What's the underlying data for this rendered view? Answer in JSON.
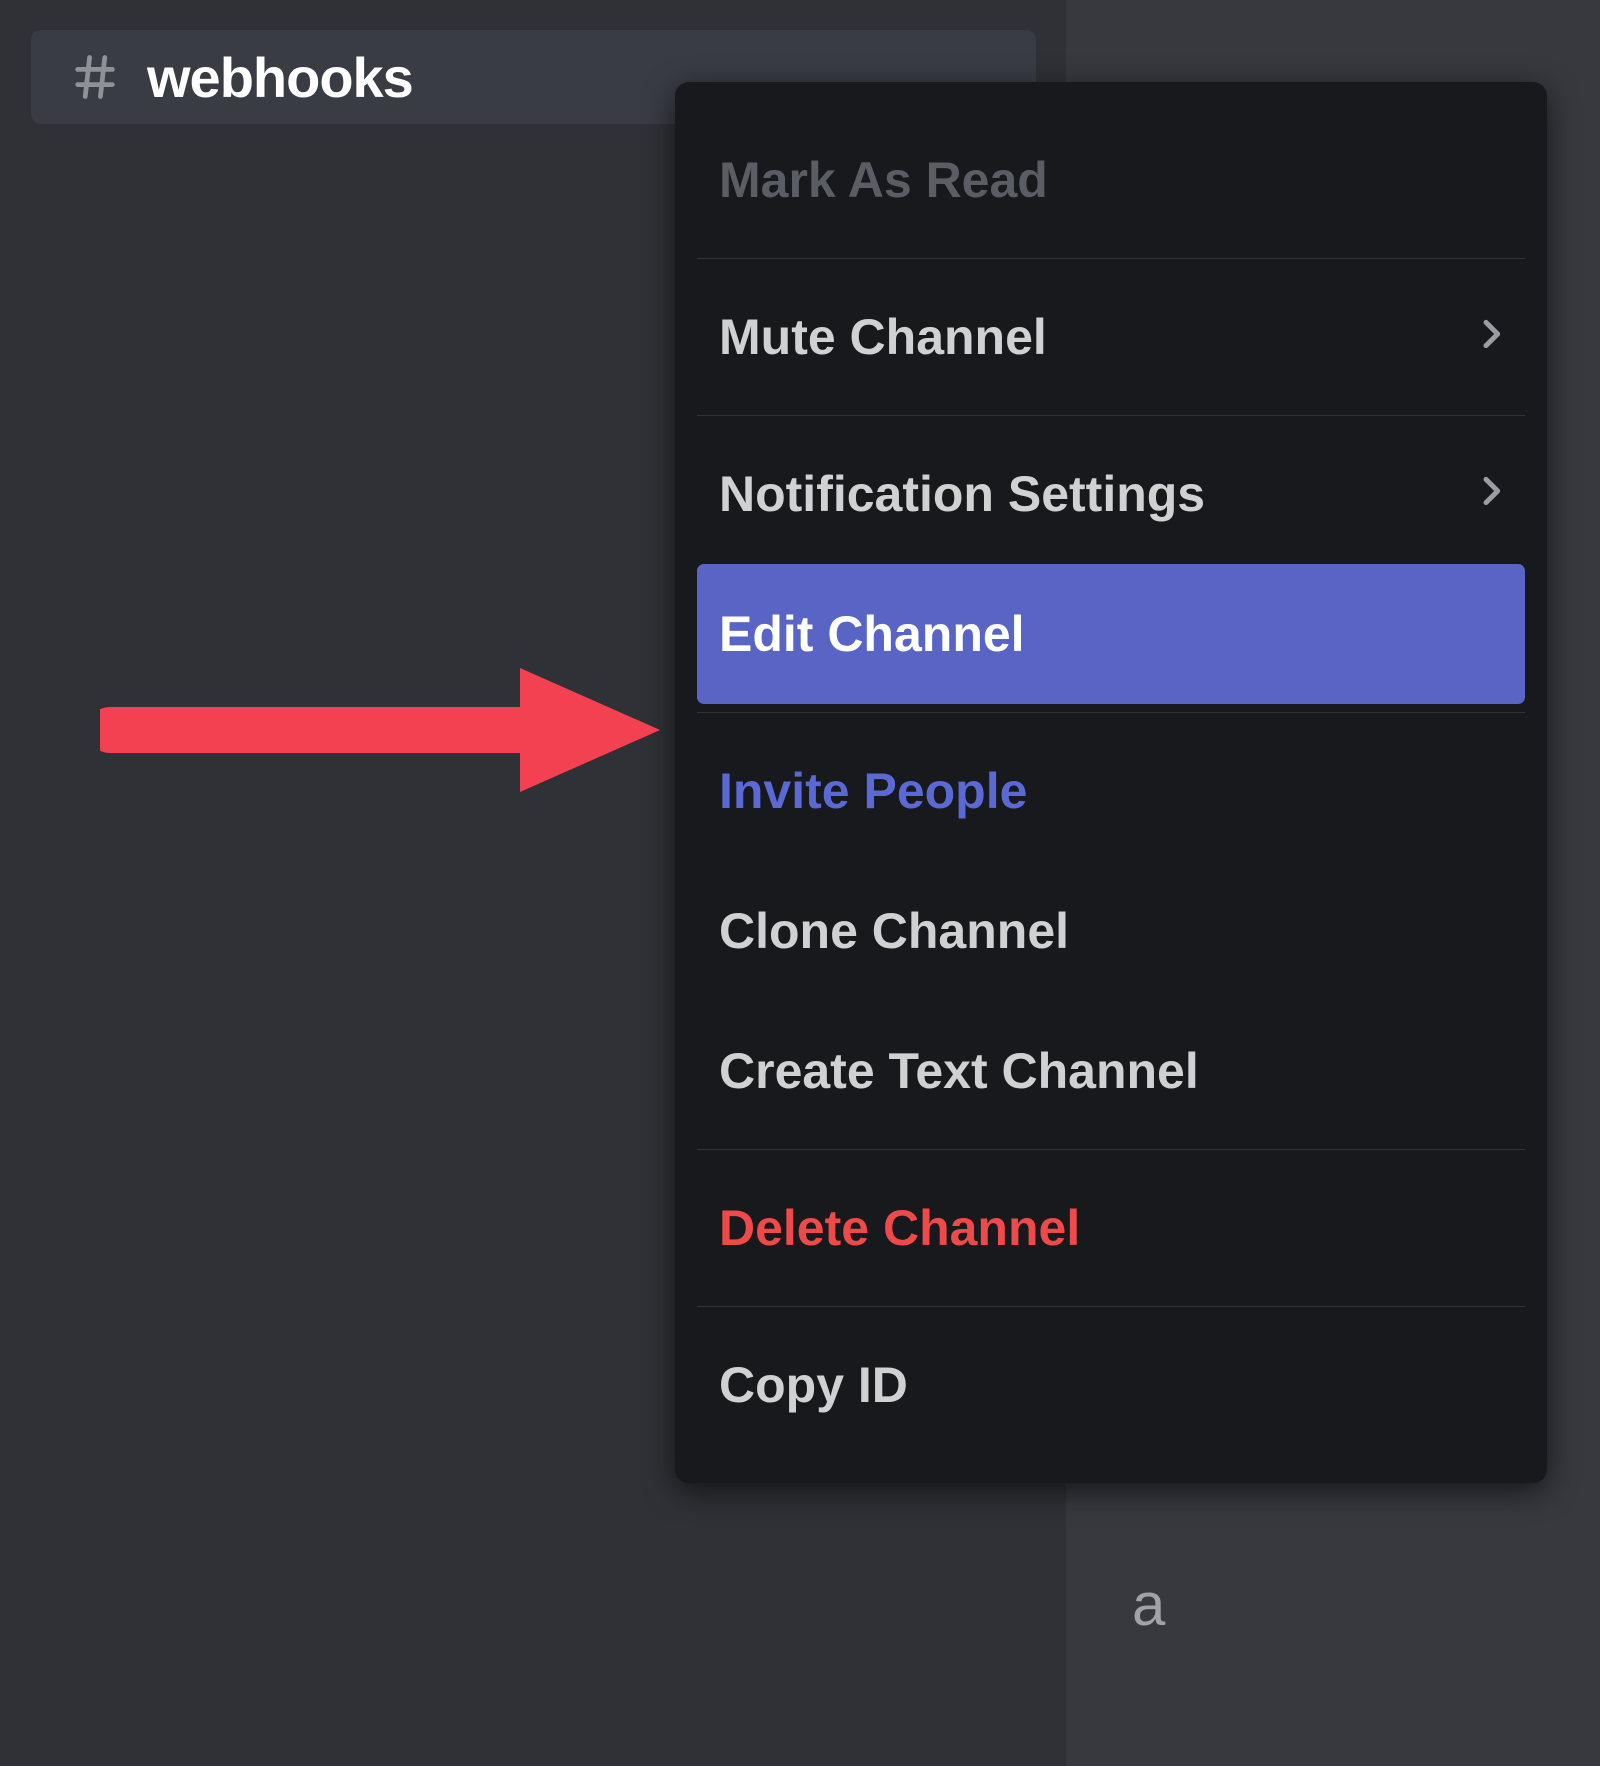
{
  "channel": {
    "name": "webhooks"
  },
  "context_menu": {
    "items": [
      {
        "label": "Mark As Read",
        "kind": "disabled"
      },
      {
        "label": "Mute Channel",
        "kind": "submenu"
      },
      {
        "label": "Notification Settings",
        "kind": "submenu"
      },
      {
        "label": "Edit Channel",
        "kind": "selected"
      },
      {
        "label": "Invite People",
        "kind": "link"
      },
      {
        "label": "Clone Channel",
        "kind": "normal"
      },
      {
        "label": "Create Text Channel",
        "kind": "normal"
      },
      {
        "label": "Delete Channel",
        "kind": "danger"
      },
      {
        "label": "Copy ID",
        "kind": "normal"
      }
    ]
  },
  "annotation": {
    "arrow_target": "Edit Channel"
  },
  "chat_fragments": {
    "line1": "",
    "line2": "a"
  }
}
